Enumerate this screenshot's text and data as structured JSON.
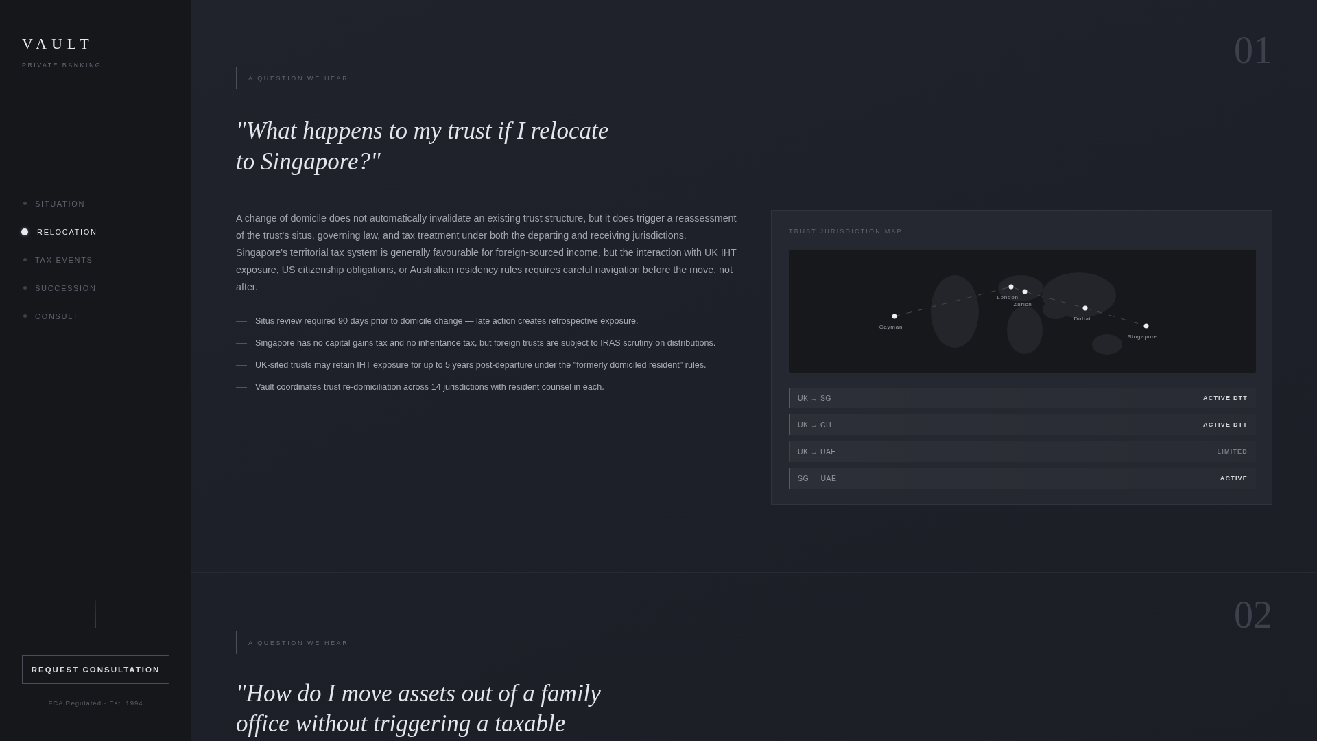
{
  "sidebar": {
    "logo": "VAULT",
    "tagline": "PRIVATE BANKING",
    "nav": [
      {
        "label": "SITUATION",
        "selected": false
      },
      {
        "label": "RELOCATION",
        "selected": true
      },
      {
        "label": "TAX EVENTS",
        "selected": false
      },
      {
        "label": "SUCCESSION",
        "selected": false
      },
      {
        "label": "CONSULT",
        "selected": false
      }
    ],
    "cta": "REQUEST CONSULTATION",
    "footer": "FCA Regulated · Est. 1994"
  },
  "sections": [
    {
      "number": "01",
      "eyebrow": "A QUESTION WE HEAR",
      "question": "\"What happens to my trust if I relocate to Singapore?\"",
      "body": "A change of domicile does not automatically invalidate an existing trust structure, but it does trigger a reassessment of the trust's situs, governing law, and tax treatment under both the departing and receiving jurisdictions. Singapore's territorial tax system is generally favourable for foreign-sourced income, but the interaction with UK IHT exposure, US citizenship obligations, or Australian residency rules requires careful navigation before the move, not after.",
      "points": [
        "Situs review required 90 days prior to domicile change — late action creates retrospective exposure.",
        "Singapore has no capital gains tax and no inheritance tax, but foreign trusts are subject to IRAS scrutiny on distributions.",
        "UK-sited trusts may retain IHT exposure for up to 5 years post-departure under the \"formerly domiciled resident\" rules.",
        "Vault coordinates trust re-domiciliation across 14 jurisdictions with resident counsel in each."
      ],
      "panel": {
        "title": "TRUST JURISDICTION MAP",
        "cities": [
          "Cayman",
          "London",
          "Zurich",
          "Dubai",
          "Singapore"
        ],
        "routes": [
          {
            "route": "UK → SG",
            "status": "ACTIVE DTT",
            "muted": false
          },
          {
            "route": "UK → CH",
            "status": "ACTIVE DTT",
            "muted": false
          },
          {
            "route": "UK → UAE",
            "status": "LIMITED",
            "muted": true
          },
          {
            "route": "SG → UAE",
            "status": "ACTIVE",
            "muted": false
          }
        ]
      }
    },
    {
      "number": "02",
      "eyebrow": "A QUESTION WE HEAR",
      "question": "\"How do I move assets out of a family office without triggering a taxable"
    }
  ]
}
